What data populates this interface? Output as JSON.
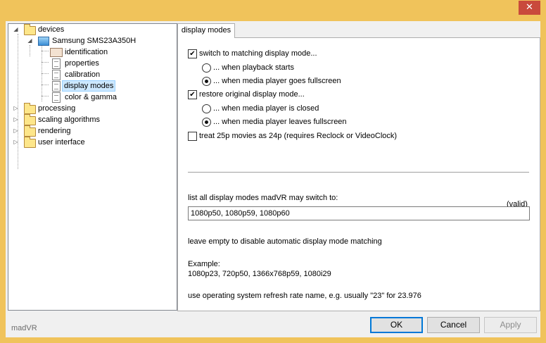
{
  "window": {
    "close_glyph": "✕"
  },
  "tree": {
    "devices": "devices",
    "device": "Samsung SMS23A350H",
    "identification": "identification",
    "properties": "properties",
    "calibration": "calibration",
    "display_modes": "display modes",
    "color_gamma": "color & gamma",
    "processing": "processing",
    "scaling": "scaling algorithms",
    "rendering": "rendering",
    "user_interface": "user interface"
  },
  "app_name": "madVR",
  "tab": {
    "label": "display modes"
  },
  "options": {
    "switch_matching": {
      "label": "switch to matching display mode...",
      "checked": true
    },
    "playback_starts": {
      "label": "... when playback starts",
      "selected": false
    },
    "goes_fullscreen": {
      "label": "... when media player goes fullscreen",
      "selected": true
    },
    "restore_original": {
      "label": "restore original display mode...",
      "checked": true
    },
    "player_closed": {
      "label": "... when media player is closed",
      "selected": false
    },
    "leaves_fullscreen": {
      "label": "... when media player leaves fullscreen",
      "selected": true
    },
    "treat_25p": {
      "label": "treat 25p movies as 24p  (requires Reclock or VideoClock)",
      "checked": false
    }
  },
  "modes": {
    "label": "list all display modes madVR may switch to:",
    "status": "(valid)",
    "value": "1080p50, 1080p59, 1080p60"
  },
  "hint_empty": "leave empty to disable automatic display mode matching",
  "example_label": "Example:",
  "example_value": "1080p23, 720p50, 1366x768p59, 1080i29",
  "hint_refresh": "use operating system refresh rate name, e.g. usually \"23\" for 23.976",
  "buttons": {
    "ok": "OK",
    "cancel": "Cancel",
    "apply": "Apply"
  },
  "icons": {
    "expanded": "expanded-arrow-icon",
    "collapsed": "collapsed-arrow-icon",
    "folder": "folder-icon",
    "monitor": "monitor-icon",
    "page": "page-icon"
  },
  "check_glyph": "✔"
}
